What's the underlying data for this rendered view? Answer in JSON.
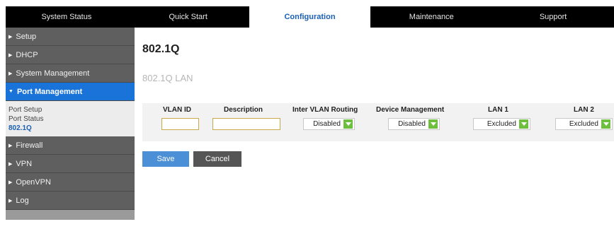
{
  "topnav": {
    "tabs": [
      {
        "label": "System Status"
      },
      {
        "label": "Quick Start"
      },
      {
        "label": "Configuration"
      },
      {
        "label": "Maintenance"
      },
      {
        "label": "Support"
      }
    ],
    "active_index": 2
  },
  "sidebar": {
    "items": [
      {
        "label": "Setup"
      },
      {
        "label": "DHCP"
      },
      {
        "label": "System Management"
      },
      {
        "label": "Port Management"
      },
      {
        "label": "Firewall"
      },
      {
        "label": "VPN"
      },
      {
        "label": "OpenVPN"
      },
      {
        "label": "Log"
      }
    ],
    "sub_items": [
      {
        "label": "Port Setup"
      },
      {
        "label": "Port Status"
      },
      {
        "label": "802.1Q"
      }
    ]
  },
  "main": {
    "page_title": "802.1Q",
    "section_title": "802.1Q LAN",
    "table": {
      "headers": [
        "VLAN ID",
        "Description",
        "Inter VLAN Routing",
        "Device Management",
        "LAN 1",
        "LAN 2"
      ],
      "row": {
        "vlan_id": "",
        "description": "",
        "inter_vlan_routing": "Disabled",
        "device_management": "Disabled",
        "lan1": "Excluded",
        "lan2": "Excluded"
      }
    },
    "buttons": {
      "save": "Save",
      "cancel": "Cancel"
    }
  },
  "colors": {
    "accent": "#1a73d9",
    "nav_bg": "#000000",
    "sidebar_bg": "#5f5f5f",
    "dropdown_arrow": "#6fbf3e"
  }
}
